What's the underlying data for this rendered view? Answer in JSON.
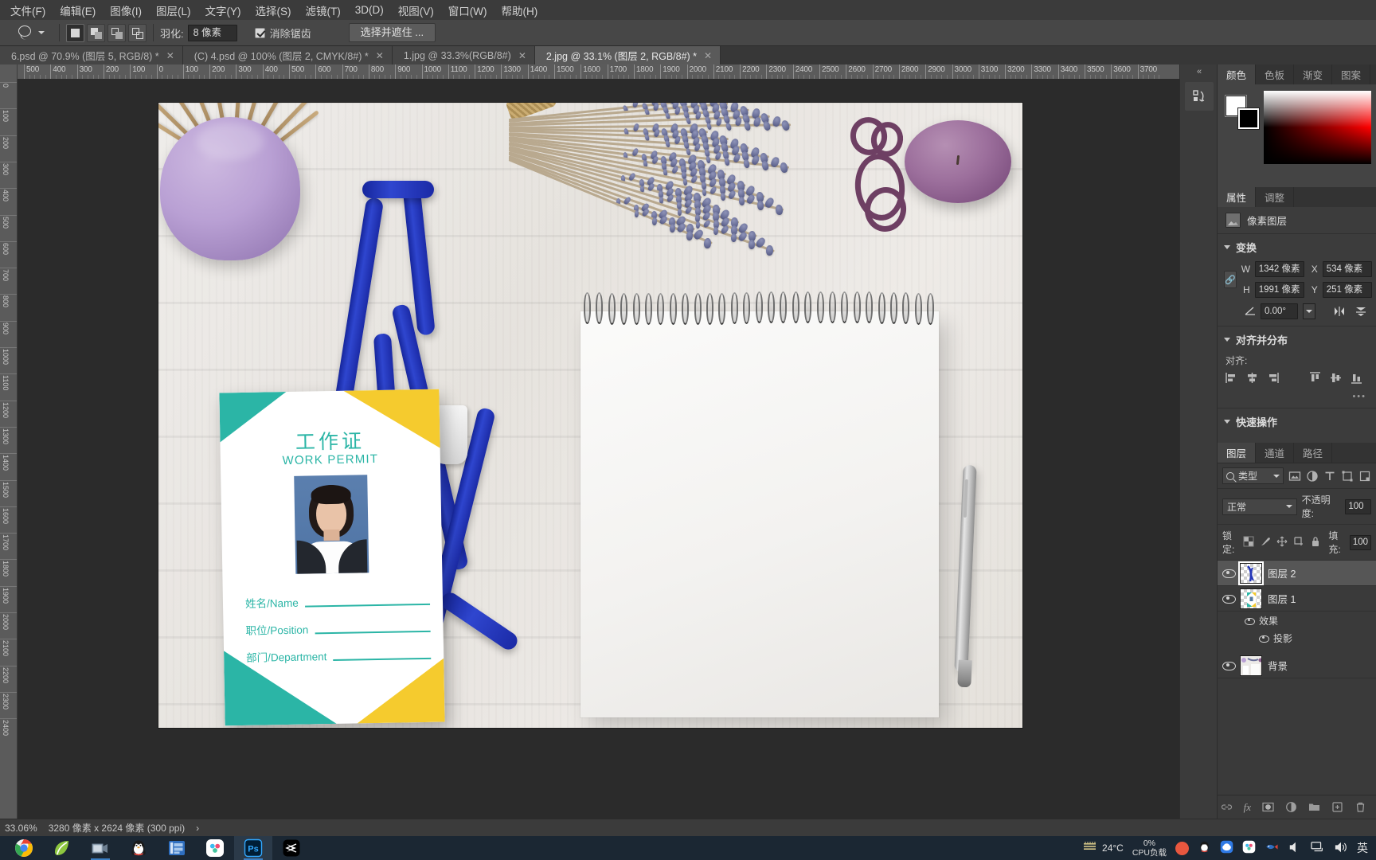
{
  "app": {
    "name": "Adobe Photoshop"
  },
  "menubar": {
    "items": [
      {
        "label": "文件(F)",
        "name": "menu-file"
      },
      {
        "label": "编辑(E)",
        "name": "menu-edit"
      },
      {
        "label": "图像(I)",
        "name": "menu-image"
      },
      {
        "label": "图层(L)",
        "name": "menu-layer"
      },
      {
        "label": "文字(Y)",
        "name": "menu-type"
      },
      {
        "label": "选择(S)",
        "name": "menu-select"
      },
      {
        "label": "滤镜(T)",
        "name": "menu-filter"
      },
      {
        "label": "3D(D)",
        "name": "menu-3d"
      },
      {
        "label": "视图(V)",
        "name": "menu-view"
      },
      {
        "label": "窗口(W)",
        "name": "menu-window"
      },
      {
        "label": "帮助(H)",
        "name": "menu-help"
      }
    ]
  },
  "options_bar": {
    "tool": "lasso-tool",
    "feather_label": "羽化:",
    "feather_value": "8 像素",
    "antialias_label": "消除锯齿",
    "antialias_checked": true,
    "select_and_mask_label": "选择并遮住 ..."
  },
  "document_tabs": [
    {
      "label": "6.psd @ 70.9% (图层 5, RGB/8) *",
      "active": false
    },
    {
      "label": "(C) 4.psd @ 100% (图层 2, CMYK/8#) *",
      "active": false
    },
    {
      "label": "1.jpg @ 33.3%(RGB/8#)",
      "active": false
    },
    {
      "label": "2.jpg @ 33.1% (图层 2, RGB/8#) *",
      "active": true
    }
  ],
  "rulers": {
    "horizontal_labels": [
      "500",
      "400",
      "300",
      "200",
      "100",
      "0",
      "100",
      "200",
      "300",
      "400",
      "500",
      "600",
      "700",
      "800",
      "900",
      "1000",
      "1100",
      "1200",
      "1300",
      "1400",
      "1500",
      "1600",
      "1700",
      "1800",
      "1900",
      "2000",
      "2100",
      "2200",
      "2300",
      "2400",
      "2500",
      "2600",
      "2700",
      "2800",
      "2900",
      "3000",
      "3100",
      "3200",
      "3300",
      "3400",
      "3500",
      "3600",
      "3700"
    ],
    "vertical_labels": [
      "0",
      "100",
      "200",
      "300",
      "400",
      "500",
      "600",
      "700",
      "800",
      "900",
      "1000",
      "1100",
      "1200",
      "1300",
      "1400",
      "1500",
      "1600",
      "1700",
      "1800",
      "1900",
      "2000",
      "2100",
      "2200",
      "2300",
      "2400"
    ]
  },
  "canvas": {
    "id_card": {
      "title": "工作证",
      "subtitle": "WORK PERMIT",
      "fields": [
        {
          "label": "姓名/Name",
          "value": ""
        },
        {
          "label": "职位/Position",
          "value": ""
        },
        {
          "label": "部门/Department",
          "value": ""
        }
      ],
      "accent_teal": "#2bb5a6",
      "accent_yellow": "#f5cb2e"
    }
  },
  "right_dock": {
    "collapse_icon": "«",
    "color_group_tabs": [
      {
        "label": "颜色",
        "active": true
      },
      {
        "label": "色板",
        "active": false
      },
      {
        "label": "渐变",
        "active": false
      },
      {
        "label": "图案",
        "active": false
      }
    ],
    "color_panel": {
      "foreground": "#ffffff",
      "background": "#000000"
    },
    "properties_group_tabs": [
      {
        "label": "属性",
        "active": true
      },
      {
        "label": "调整",
        "active": false
      }
    ],
    "properties": {
      "layer_type": "像素图层",
      "transform": {
        "section_title": "变换",
        "w_label": "W",
        "w_value": "1342 像素",
        "x_label": "X",
        "x_value": "534 像素",
        "h_label": "H",
        "h_value": "1991 像素",
        "y_label": "Y",
        "y_value": "251 像素",
        "angle_value": "0.00°"
      },
      "align": {
        "section_title": "对齐并分布",
        "align_label": "对齐:",
        "overflow": "•••"
      },
      "quick_actions": {
        "section_title": "快速操作"
      }
    },
    "layers_group_tabs": [
      {
        "label": "图层",
        "active": true
      },
      {
        "label": "通道",
        "active": false
      },
      {
        "label": "路径",
        "active": false
      }
    ],
    "layers": {
      "filter_kind": "类型",
      "blend_mode": "正常",
      "opacity_label": "不透明度:",
      "opacity_value": "100",
      "lock_label": "锁定:",
      "fill_label": "填充:",
      "fill_value": "100",
      "rows": [
        {
          "name": "图层 2",
          "visible": true,
          "selected": true,
          "thumb": "transparent-ribbon",
          "effects": []
        },
        {
          "name": "图层 1",
          "visible": true,
          "selected": false,
          "thumb": "transparent-card",
          "effects": [
            {
              "name": "效果",
              "visible": true
            },
            {
              "name": "投影",
              "visible": true
            }
          ]
        },
        {
          "name": "背景",
          "visible": true,
          "selected": false,
          "thumb": "photo-bg",
          "effects": []
        }
      ]
    }
  },
  "status_bar": {
    "zoom": "33.06%",
    "dimensions": "3280 像素 x 2624 像素 (300 ppi)",
    "arrow": "›"
  },
  "taskbar": {
    "apps": [
      {
        "name": "chrome",
        "running": false
      },
      {
        "name": "leaf-app",
        "running": false
      },
      {
        "name": "screenshot-tool",
        "running": true
      },
      {
        "name": "qq",
        "running": false
      },
      {
        "name": "video-app",
        "running": false
      },
      {
        "name": "baidu-netdisk",
        "running": false
      },
      {
        "name": "photoshop",
        "running": true,
        "active": true
      },
      {
        "name": "capcut",
        "running": false
      }
    ],
    "temperature": "24°C",
    "cpu_percent": "0%",
    "cpu_label": "CPU负载",
    "ime": "英"
  }
}
